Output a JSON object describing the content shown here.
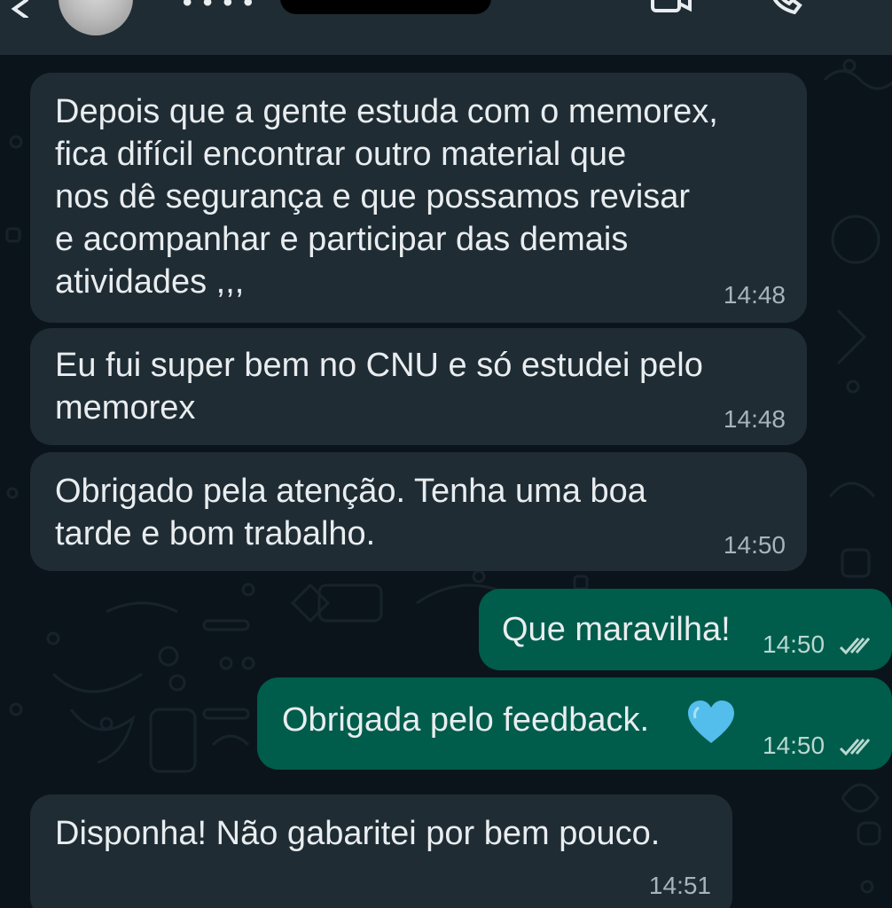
{
  "header": {
    "contact_name_visible": "• • • •"
  },
  "messages": [
    {
      "direction": "incoming",
      "text": "Depois que a gente estuda com o memorex,\nfica difícil encontrar outro material que\nnos dê segurança e que possamos revisar\ne acompanhar e participar das demais\natividades ,,,",
      "time": "14:48"
    },
    {
      "direction": "incoming",
      "text": "Eu fui super bem no CNU e só estudei pelo\nmemorex",
      "time": "14:48"
    },
    {
      "direction": "incoming",
      "text": "Obrigado pela atenção. Tenha uma boa\ntarde e bom trabalho.",
      "time": "14:50"
    },
    {
      "direction": "outgoing",
      "text": "Que maravilha!",
      "time": "14:50",
      "status_icon": "double-check-icon"
    },
    {
      "direction": "outgoing",
      "text": "Obrigada pelo feedback.",
      "emoji_icon": "blue-heart-icon",
      "time": "14:50",
      "status_icon": "double-check-icon"
    },
    {
      "direction": "incoming",
      "text": "Disponha! Não gabaritei por bem pouco.",
      "time": "14:51"
    }
  ],
  "colors": {
    "background": "#0b141a",
    "incoming_bubble": "#1f2c34",
    "outgoing_bubble": "#005c4b",
    "text": "#e9edef",
    "heart": "#53bdeb"
  }
}
